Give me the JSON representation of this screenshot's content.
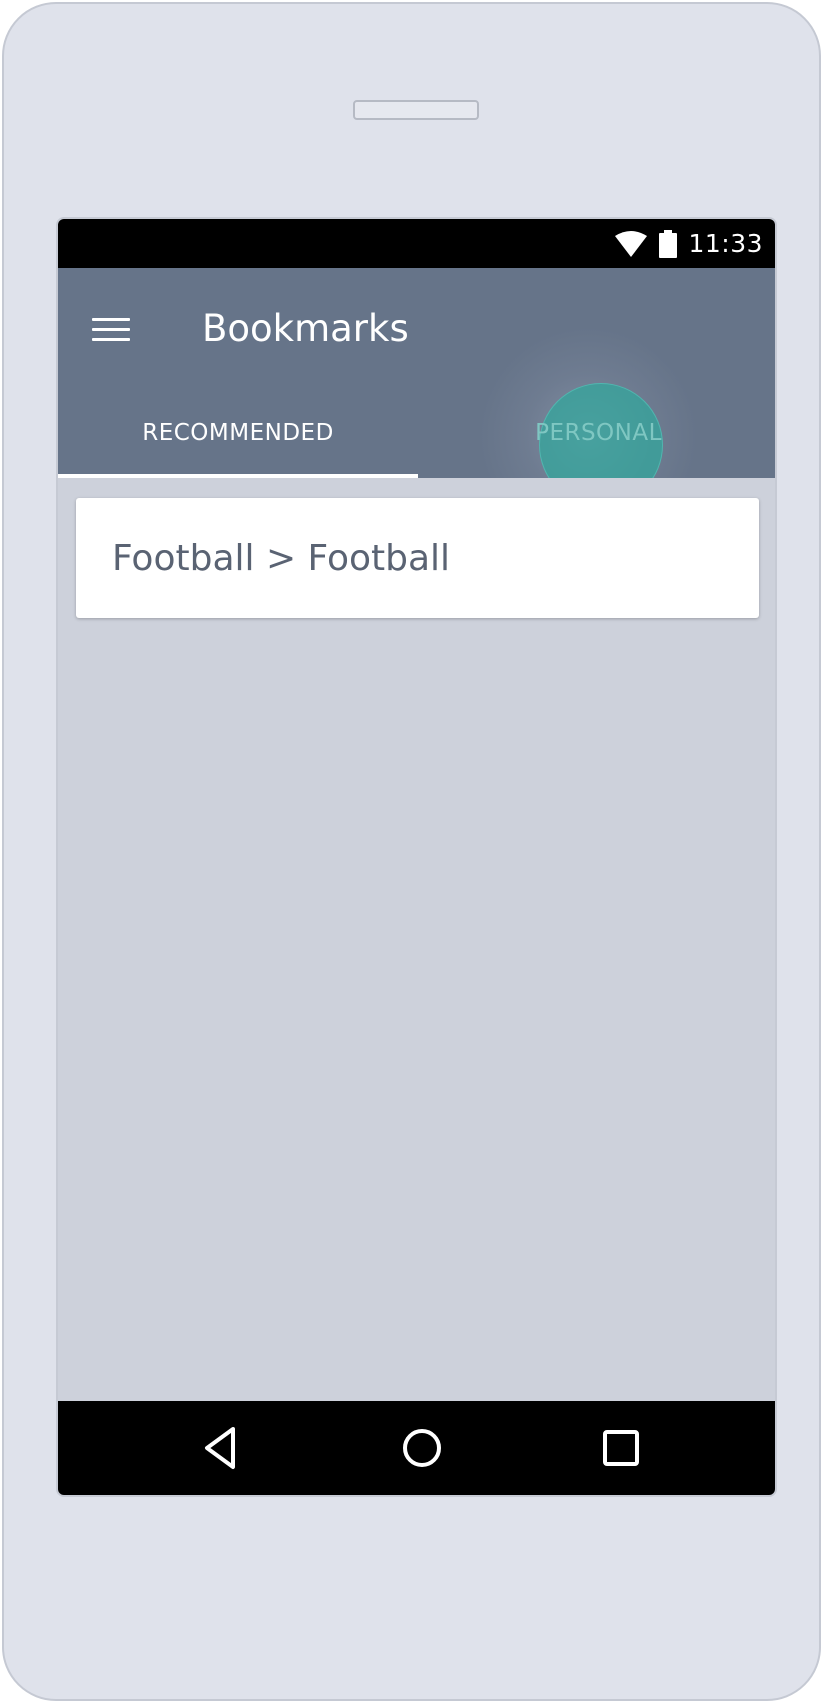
{
  "status_bar": {
    "time": "11:33",
    "icons": [
      "wifi-icon",
      "battery-icon"
    ]
  },
  "app_bar": {
    "title": "Bookmarks",
    "menu_icon": "hamburger-menu-icon",
    "background_color": "#667489"
  },
  "tabs": [
    {
      "label": "RECOMMENDED",
      "selected": true
    },
    {
      "label": "PERSONAL",
      "selected": false,
      "pressed": true
    }
  ],
  "bookmarks": [
    {
      "label": "Football > Football"
    }
  ],
  "nav_bar": {
    "icons": [
      "back-icon",
      "home-icon",
      "recents-icon"
    ]
  },
  "colors": {
    "accent": "#30a89c",
    "content_background": "#cdd1db",
    "device_frame": "#dfe2eb"
  }
}
